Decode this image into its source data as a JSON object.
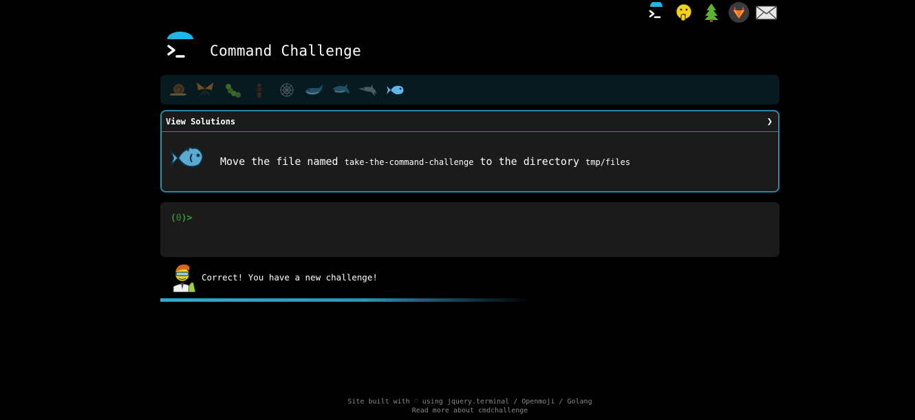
{
  "header": {
    "title": "Command Challenge",
    "logo": "terminal-logo-icon"
  },
  "top_nav": {
    "items": [
      {
        "name": "terminal-icon"
      },
      {
        "name": "shushing-face-icon"
      },
      {
        "name": "tree-icon"
      },
      {
        "name": "gitlab-icon"
      },
      {
        "name": "envelope-icon"
      }
    ]
  },
  "challenges": [
    {
      "name": "snail-icon",
      "state": "done"
    },
    {
      "name": "butterfly-icon",
      "state": "done"
    },
    {
      "name": "caterpillar-icon",
      "state": "done"
    },
    {
      "name": "ant-icon",
      "state": "done"
    },
    {
      "name": "web-icon",
      "state": "done"
    },
    {
      "name": "whale-icon",
      "state": "done"
    },
    {
      "name": "shark-icon",
      "state": "done"
    },
    {
      "name": "dolphin-icon",
      "state": "done"
    },
    {
      "name": "fish-icon",
      "state": "current"
    }
  ],
  "task": {
    "view_solutions_label": "View Solutions",
    "chevron": "❯",
    "text_before": "Move the file named ",
    "file_name": "take-the-command-challenge",
    "text_middle": " to the directory ",
    "dir_name": "tmp/files",
    "icon": "fish-icon"
  },
  "terminal": {
    "prompt_open": "(",
    "prompt_count": "0",
    "prompt_close": ")>"
  },
  "result": {
    "message": "Correct! You have a new challenge!"
  },
  "progress": {
    "value": 0.6
  },
  "colors": {
    "accent": "#2a8aa6",
    "prompt_green": "#2fd42f",
    "panel_bg": "#1b1b1b",
    "bar_bg": "#071a20"
  },
  "footer": {
    "line1": "Site built with ♡ using jquery.terminal / Openmoji / Golang",
    "line2": "Read more about cmdchallenge"
  }
}
